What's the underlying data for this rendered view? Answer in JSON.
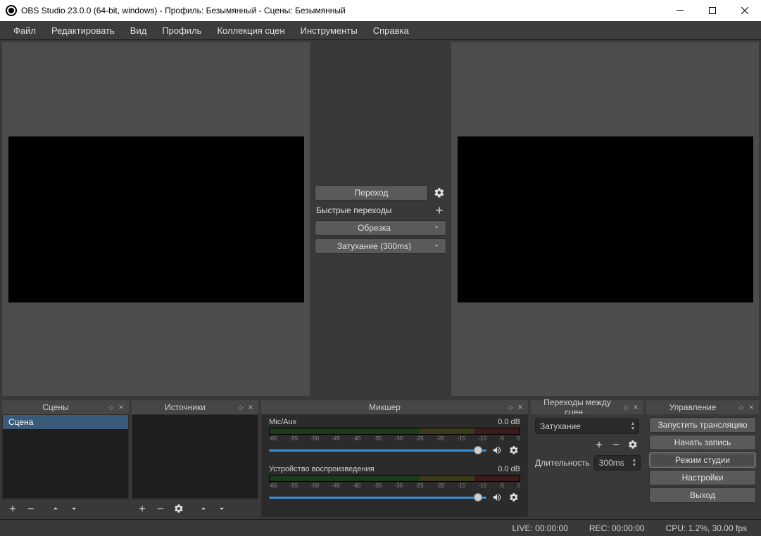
{
  "window": {
    "title": "OBS Studio 23.0.0 (64-bit, windows) - Профиль: Безымянный - Сцены: Безымянный"
  },
  "menu": [
    "Файл",
    "Редактировать",
    "Вид",
    "Профиль",
    "Коллекция сцен",
    "Инструменты",
    "Справка"
  ],
  "transition": {
    "button": "Переход",
    "quick_label": "Быстрые переходы",
    "items": [
      "Обрезка",
      "Затухание (300ms)"
    ]
  },
  "docks": {
    "scenes": {
      "title": "Сцены",
      "items": [
        "Сцена"
      ]
    },
    "sources": {
      "title": "Источники"
    },
    "mixer": {
      "title": "Микшер",
      "channels": [
        {
          "name": "Mic/Aux",
          "db": "0.0 dB"
        },
        {
          "name": "Устройство воспроизведения",
          "db": "0.0 dB"
        }
      ],
      "ticks": [
        "-60",
        "-55",
        "-50",
        "-45",
        "-40",
        "-35",
        "-30",
        "-25",
        "-20",
        "-15",
        "-10",
        "-5",
        "0"
      ]
    },
    "transitions": {
      "title": "Переходы между сцен...",
      "selected": "Затухание",
      "duration_label": "Длительность",
      "duration_value": "300ms"
    },
    "controls": {
      "title": "Управление",
      "buttons": [
        "Запустить трансляцию",
        "Начать запись",
        "Режим студии",
        "Настройки",
        "Выход"
      ],
      "active_index": 2
    }
  },
  "status": {
    "live": "LIVE: 00:00:00",
    "rec": "REC: 00:00:00",
    "cpu": "CPU: 1.2%, 30.00 fps"
  }
}
